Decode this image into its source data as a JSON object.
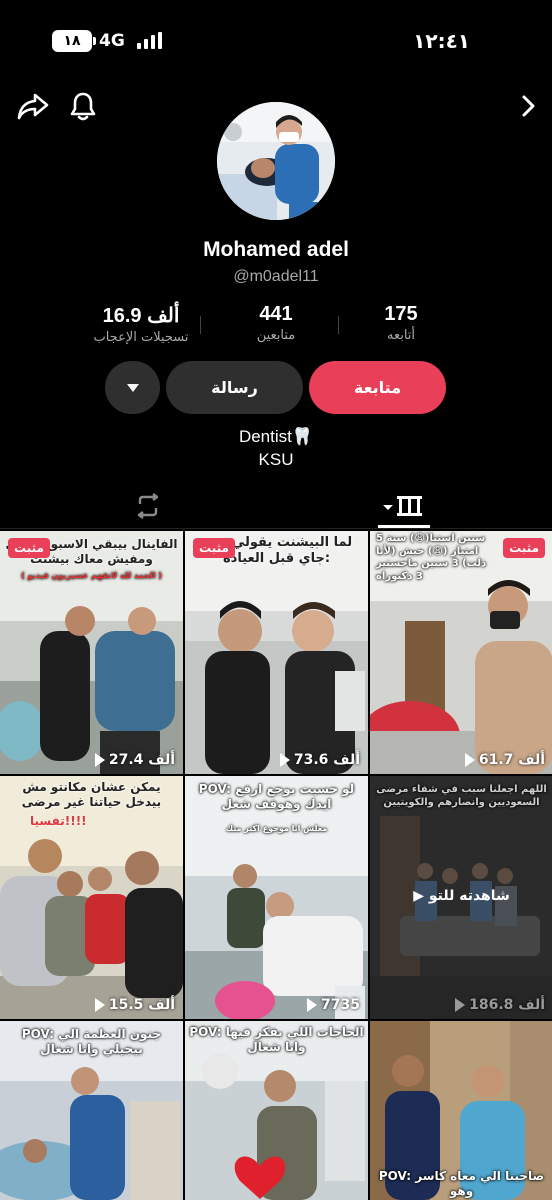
{
  "status_bar": {
    "battery": "١٨",
    "network": "4G",
    "time": "١٢:٤١"
  },
  "profile": {
    "name": "Mohamed adel",
    "handle": "@m0adel11",
    "stats": [
      {
        "value": "16.9 ألف",
        "label": "تسجيلات الإعجاب"
      },
      {
        "value": "441",
        "label": "متابعين"
      },
      {
        "value": "175",
        "label": "أتابعه"
      }
    ],
    "buttons": {
      "follow": "متابعة",
      "message": "رسالة"
    },
    "bio": [
      "Dentist🦷",
      "KSU"
    ]
  },
  "videos": [
    {
      "pinned": "مثبت",
      "caption": "الفاينال بيبقي الاسبوع الجاي ومفيش معاك بيشنت",
      "subcaption": "( الحمد لله لاتفهم عسيريون فيديو )",
      "views": "27.4 ألف"
    },
    {
      "pinned": "مثبت",
      "caption": "لما البيشنت يقولي مش جاي قبل العياده:",
      "views": "73.6 ألف"
    },
    {
      "pinned": "مثبت",
      "caption": "5 سنين استنا(😩) سنة امتياز (😩) جيش (لأنا ذلت) 3 سنين ماجستير 3 دكتوراه",
      "views": "61.7 ألف"
    },
    {
      "caption": "يمكن عشان مكانتو مش بيدخل حياتنا غير مرضى",
      "subcaption": "تفسيا!!!!",
      "views": "15.5 ألف"
    },
    {
      "caption": "POV: لو حسيت بوجع ارفع ايدك وهوقف شغل",
      "subcaption": "معلش انا موجوع اكتر منك",
      "views": "7735"
    },
    {
      "caption": "اللهم اجعلنا سبب في شفاء مرضى السعوديين وانصارهم والكويتيين",
      "watched": "شاهدته للتو",
      "views": "186.8 ألف"
    },
    {
      "caption": "POV: جنون العظمة الي بيجيلي وانا شغال"
    },
    {
      "caption": "POV: الحاجات اللي بفكر فيها وانا شغال"
    },
    {
      "caption": "POV: صاحبنا الي معاه كاسر وهو"
    }
  ],
  "icons": [
    "share-icon",
    "bell-icon",
    "chevron-right-icon",
    "caret-down-icon",
    "repost-icon",
    "grid-icon"
  ],
  "colors": {
    "accent": "#ea3f58",
    "button_secondary": "#2f2f2f",
    "background": "#000000"
  }
}
